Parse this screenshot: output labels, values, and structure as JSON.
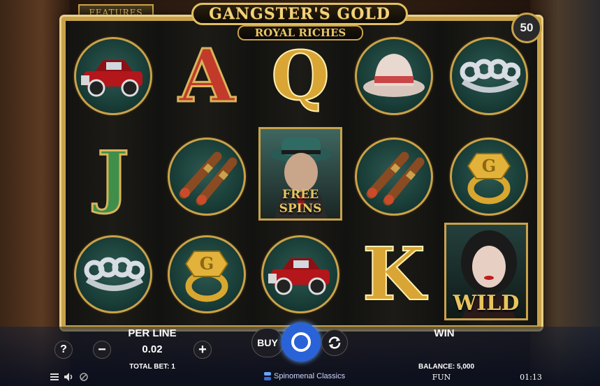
{
  "game": {
    "title": "GANGSTER'S GOLD",
    "subtitle": "ROYAL RICHES",
    "features_label": "FEATURES",
    "lines_count": "50"
  },
  "reels": [
    [
      "car-symbol",
      "letter-j",
      "brass-knuckles-symbol"
    ],
    [
      "letter-a",
      "cigars-symbol",
      "gold-ring-symbol"
    ],
    [
      "letter-q",
      "free-spins-symbol",
      "car-symbol"
    ],
    [
      "fedora-hat-symbol",
      "cigars-symbol",
      "letter-k"
    ],
    [
      "brass-knuckles-symbol",
      "gold-ring-symbol",
      "wild-symbol"
    ]
  ],
  "letters": {
    "a": "A",
    "q": "Q",
    "j": "J",
    "k": "K"
  },
  "free_spins_label": "FREE SPINS",
  "wild_label": "WILD",
  "controls": {
    "info_label": "?",
    "per_line_label": "PER LINE",
    "per_line_value": "0.02",
    "minus_label": "−",
    "plus_label": "+",
    "total_bet_label": "TOTAL BET: 1",
    "buy_label": "BUY",
    "win_label": "WIN",
    "balance_label": "BALANCE: 5,000",
    "mode_label": "FUN",
    "time": "01:13",
    "provider": "Spinomenal Classics"
  },
  "colors": {
    "gold": "#c9a24a",
    "spin_blue": "#2a63d8",
    "car_red": "#b3161b",
    "letter_red": "#c23a2a",
    "letter_green": "#3f8f4a"
  }
}
